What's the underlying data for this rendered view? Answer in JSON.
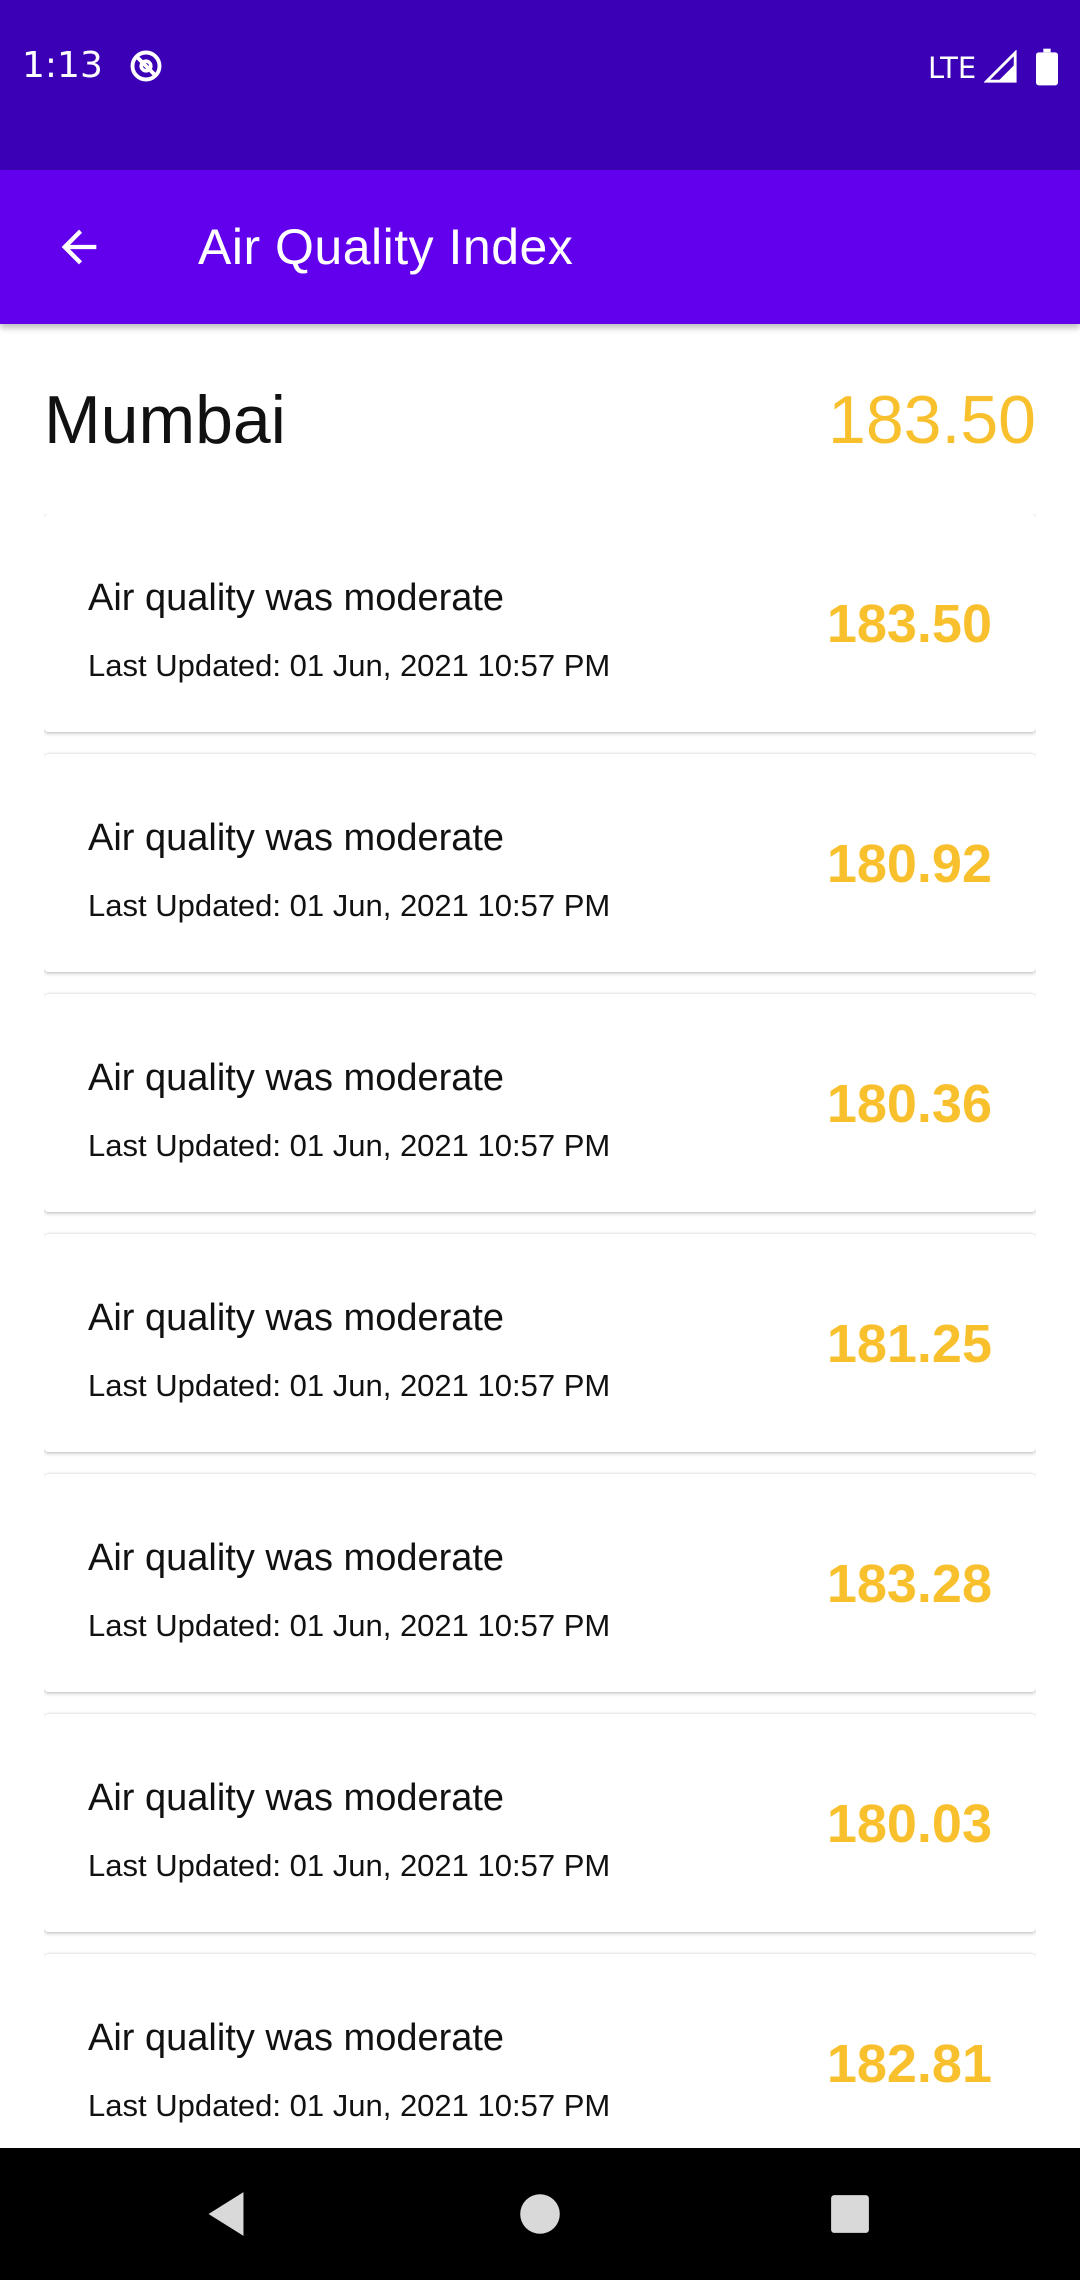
{
  "status_bar": {
    "time": "1:13",
    "network": "LTE",
    "icons": [
      "do-not-disturb-icon",
      "signal-icon",
      "battery-icon"
    ]
  },
  "app_bar": {
    "title": "Air Quality Index",
    "back_icon": "arrow-back-icon",
    "color": "#6200ee"
  },
  "city": {
    "name": "Mumbai",
    "aqi": "183.50"
  },
  "colors": {
    "status_bar": "#3b00b5",
    "aqi_moderate": "#f9c02d"
  },
  "readings": [
    {
      "status": "Air quality was moderate",
      "updated": "Last Updated: 01 Jun, 2021 10:57 PM",
      "value": "183.50"
    },
    {
      "status": "Air quality was moderate",
      "updated": "Last Updated: 01 Jun, 2021 10:57 PM",
      "value": "180.92"
    },
    {
      "status": "Air quality was moderate",
      "updated": "Last Updated: 01 Jun, 2021 10:57 PM",
      "value": "180.36"
    },
    {
      "status": "Air quality was moderate",
      "updated": "Last Updated: 01 Jun, 2021 10:57 PM",
      "value": "181.25"
    },
    {
      "status": "Air quality was moderate",
      "updated": "Last Updated: 01 Jun, 2021 10:57 PM",
      "value": "183.28"
    },
    {
      "status": "Air quality was moderate",
      "updated": "Last Updated: 01 Jun, 2021 10:57 PM",
      "value": "180.03"
    },
    {
      "status": "Air quality was moderate",
      "updated": "Last Updated: 01 Jun, 2021 10:57 PM",
      "value": "182.81"
    }
  ],
  "nav_bar": {
    "buttons": [
      "back-triangle-icon",
      "home-circle-icon",
      "recents-square-icon"
    ]
  }
}
